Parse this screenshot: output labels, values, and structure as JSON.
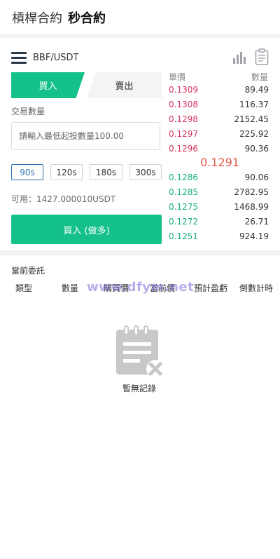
{
  "header": {
    "tab_leverage": "槓桿合約",
    "tab_second": "秒合約"
  },
  "pair": {
    "symbol": "BBF/USDT",
    "menu_icon": "hamburger-menu-icon",
    "chart_icon": "bar-chart-icon",
    "orders_icon": "clipboard-icon"
  },
  "trade": {
    "buy_tab": "買入",
    "sell_tab": "賣出",
    "quantity_label": "交易數量",
    "quantity_placeholder": "請輸入最低起投數量100.00",
    "quantity_value": "",
    "durations": [
      "90s",
      "120s",
      "180s",
      "300s"
    ],
    "selected_duration": "90s",
    "available": "可用：1427.000010USDT",
    "buy_long_button": "買入 (做多)"
  },
  "orderbook": {
    "price_header": "單價",
    "qty_header": "數量",
    "asks": [
      {
        "price": "0.1309",
        "qty": "89.49"
      },
      {
        "price": "0.1308",
        "qty": "116.37"
      },
      {
        "price": "0.1298",
        "qty": "2152.45"
      },
      {
        "price": "0.1297",
        "qty": "225.92"
      },
      {
        "price": "0.1296",
        "qty": "90.36"
      }
    ],
    "last_price": "0.1291",
    "bids": [
      {
        "price": "0.1286",
        "qty": "90.06"
      },
      {
        "price": "0.1285",
        "qty": "2782.95"
      },
      {
        "price": "0.1275",
        "qty": "1468.99"
      },
      {
        "price": "0.1272",
        "qty": "26.71"
      },
      {
        "price": "0.1251",
        "qty": "924.19"
      }
    ]
  },
  "orders": {
    "title": "當前委託",
    "columns": [
      "類型",
      "數量",
      "購買價",
      "當前價",
      "預計盈虧",
      "倒數計時"
    ],
    "empty_text": "暫無記錄",
    "empty_icon": "empty-clipboard-icon"
  },
  "watermark": "www.dfym.net",
  "colors": {
    "buy_green": "#14c18a",
    "ask_red": "#d6335d",
    "bid_green": "#14b07e",
    "last_price": "#e85a4a",
    "active_duration": "#2d6fb0"
  }
}
